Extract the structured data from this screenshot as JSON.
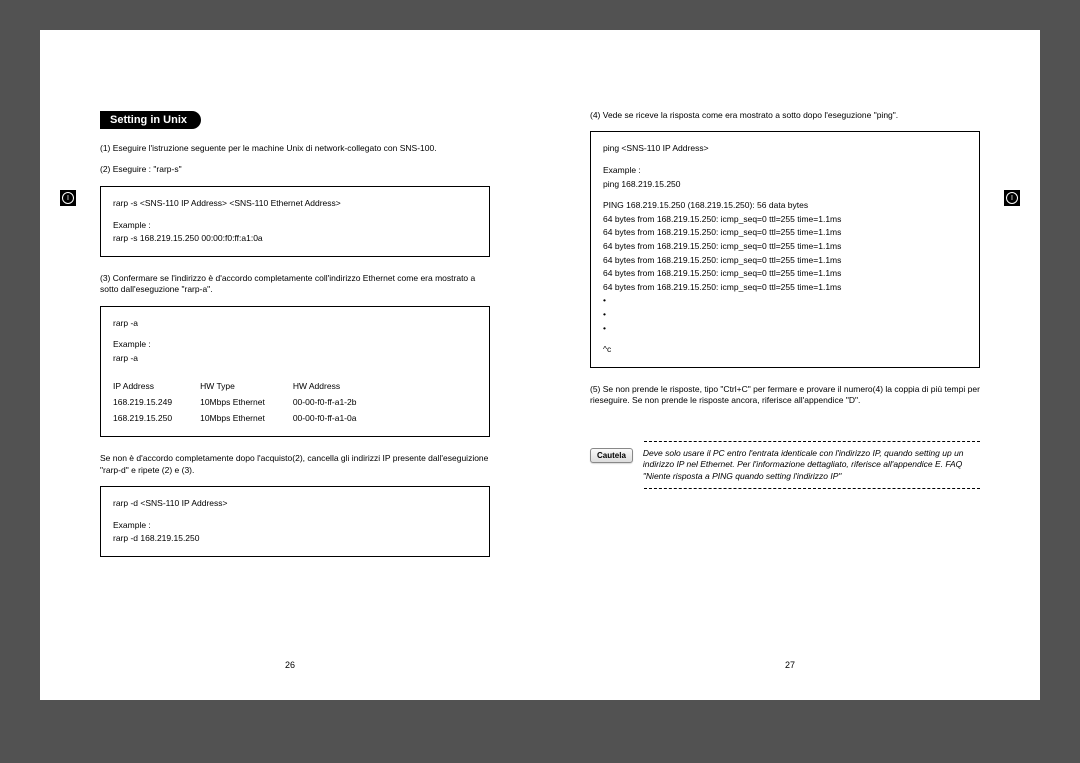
{
  "left": {
    "heading": "Setting in Unix",
    "p1": "(1) Eseguire l'istruzione seguente per le machine Unix di network-collegato con SNS-100.",
    "p2": "(2) Eseguire : \"rarp-s\"",
    "box1": {
      "l1": "rarp -s <SNS-110 IP Address> <SNS-110 Ethernet Address>",
      "l2": "Example :",
      "l3": "rarp -s 168.219.15.250 00:00:f0:ff:a1:0a"
    },
    "p3": "(3) Confermare se l'indirizzo è d'accordo completamente coll'indirizzo Ethernet come era mostrato a sotto dall'eseguzione \"rarp-a\".",
    "box2": {
      "l1": "rarp -a",
      "l2": "Example :",
      "l3": "rarp -a",
      "th1": "IP Address",
      "th2": "HW Type",
      "th3": "HW Address",
      "r1c1": "168.219.15.249",
      "r1c2": "10Mbps Ethernet",
      "r1c3": "00-00-f0-ff-a1-2b",
      "r2c1": "168.219.15.250",
      "r2c2": "10Mbps Ethernet",
      "r2c3": "00-00-f0-ff-a1-0a"
    },
    "p4": "Se non è d'accordo completamente dopo l'acquisto(2), cancella gli indirizzi IP presente dall'eseguizione \"rarp-d\" e ripete (2) e (3).",
    "box3": {
      "l1": "rarp -d <SNS-110 IP Address>",
      "l2": "Example :",
      "l3": "rarp -d 168.219.15.250"
    },
    "pageNum": "26"
  },
  "right": {
    "p4": "(4) Vede se riceve la risposta come era mostrato a sotto dopo l'eseguzione \"ping\".",
    "box4": {
      "l1": "ping <SNS-110 IP Address>",
      "l2": "Example :",
      "l3": "ping 168.219.15.250",
      "l4": "PING 168.219.15.250 (168.219.15.250): 56 data bytes",
      "l5": "64 bytes from 168.219.15.250: icmp_seq=0 ttl=255 time=1.1ms",
      "l6": "64 bytes from 168.219.15.250: icmp_seq=0 ttl=255 time=1.1ms",
      "l7": "64 bytes from 168.219.15.250: icmp_seq=0 ttl=255 time=1.1ms",
      "l8": "64 bytes from 168.219.15.250: icmp_seq=0 ttl=255 time=1.1ms",
      "l9": "64 bytes from 168.219.15.250: icmp_seq=0 ttl=255 time=1.1ms",
      "l10": "64 bytes from 168.219.15.250: icmp_seq=0 ttl=255 time=1.1ms",
      "dot": "•",
      "ctrlc": "^c"
    },
    "p5": "(5) Se non prende le risposte, tipo \"Ctrl+C\" per fermare e provare il numero(4) la coppia di più tempi per rieseguire. Se non prende le risposte ancora, riferisce all'appendice \"D\".",
    "caution": {
      "label": "Cautela",
      "text": "Deve solo usare il PC entro l'entrata identicale con l'indirizzo IP, quando setting up un indirizzo IP nel Ethernet.\nPer l'informazione dettagliato, riferisce all'appendice E. FAQ \"Niente risposta a PING quando setting l'indirizzo IP\""
    },
    "pageNum": "27"
  },
  "markerGlyph": "I"
}
